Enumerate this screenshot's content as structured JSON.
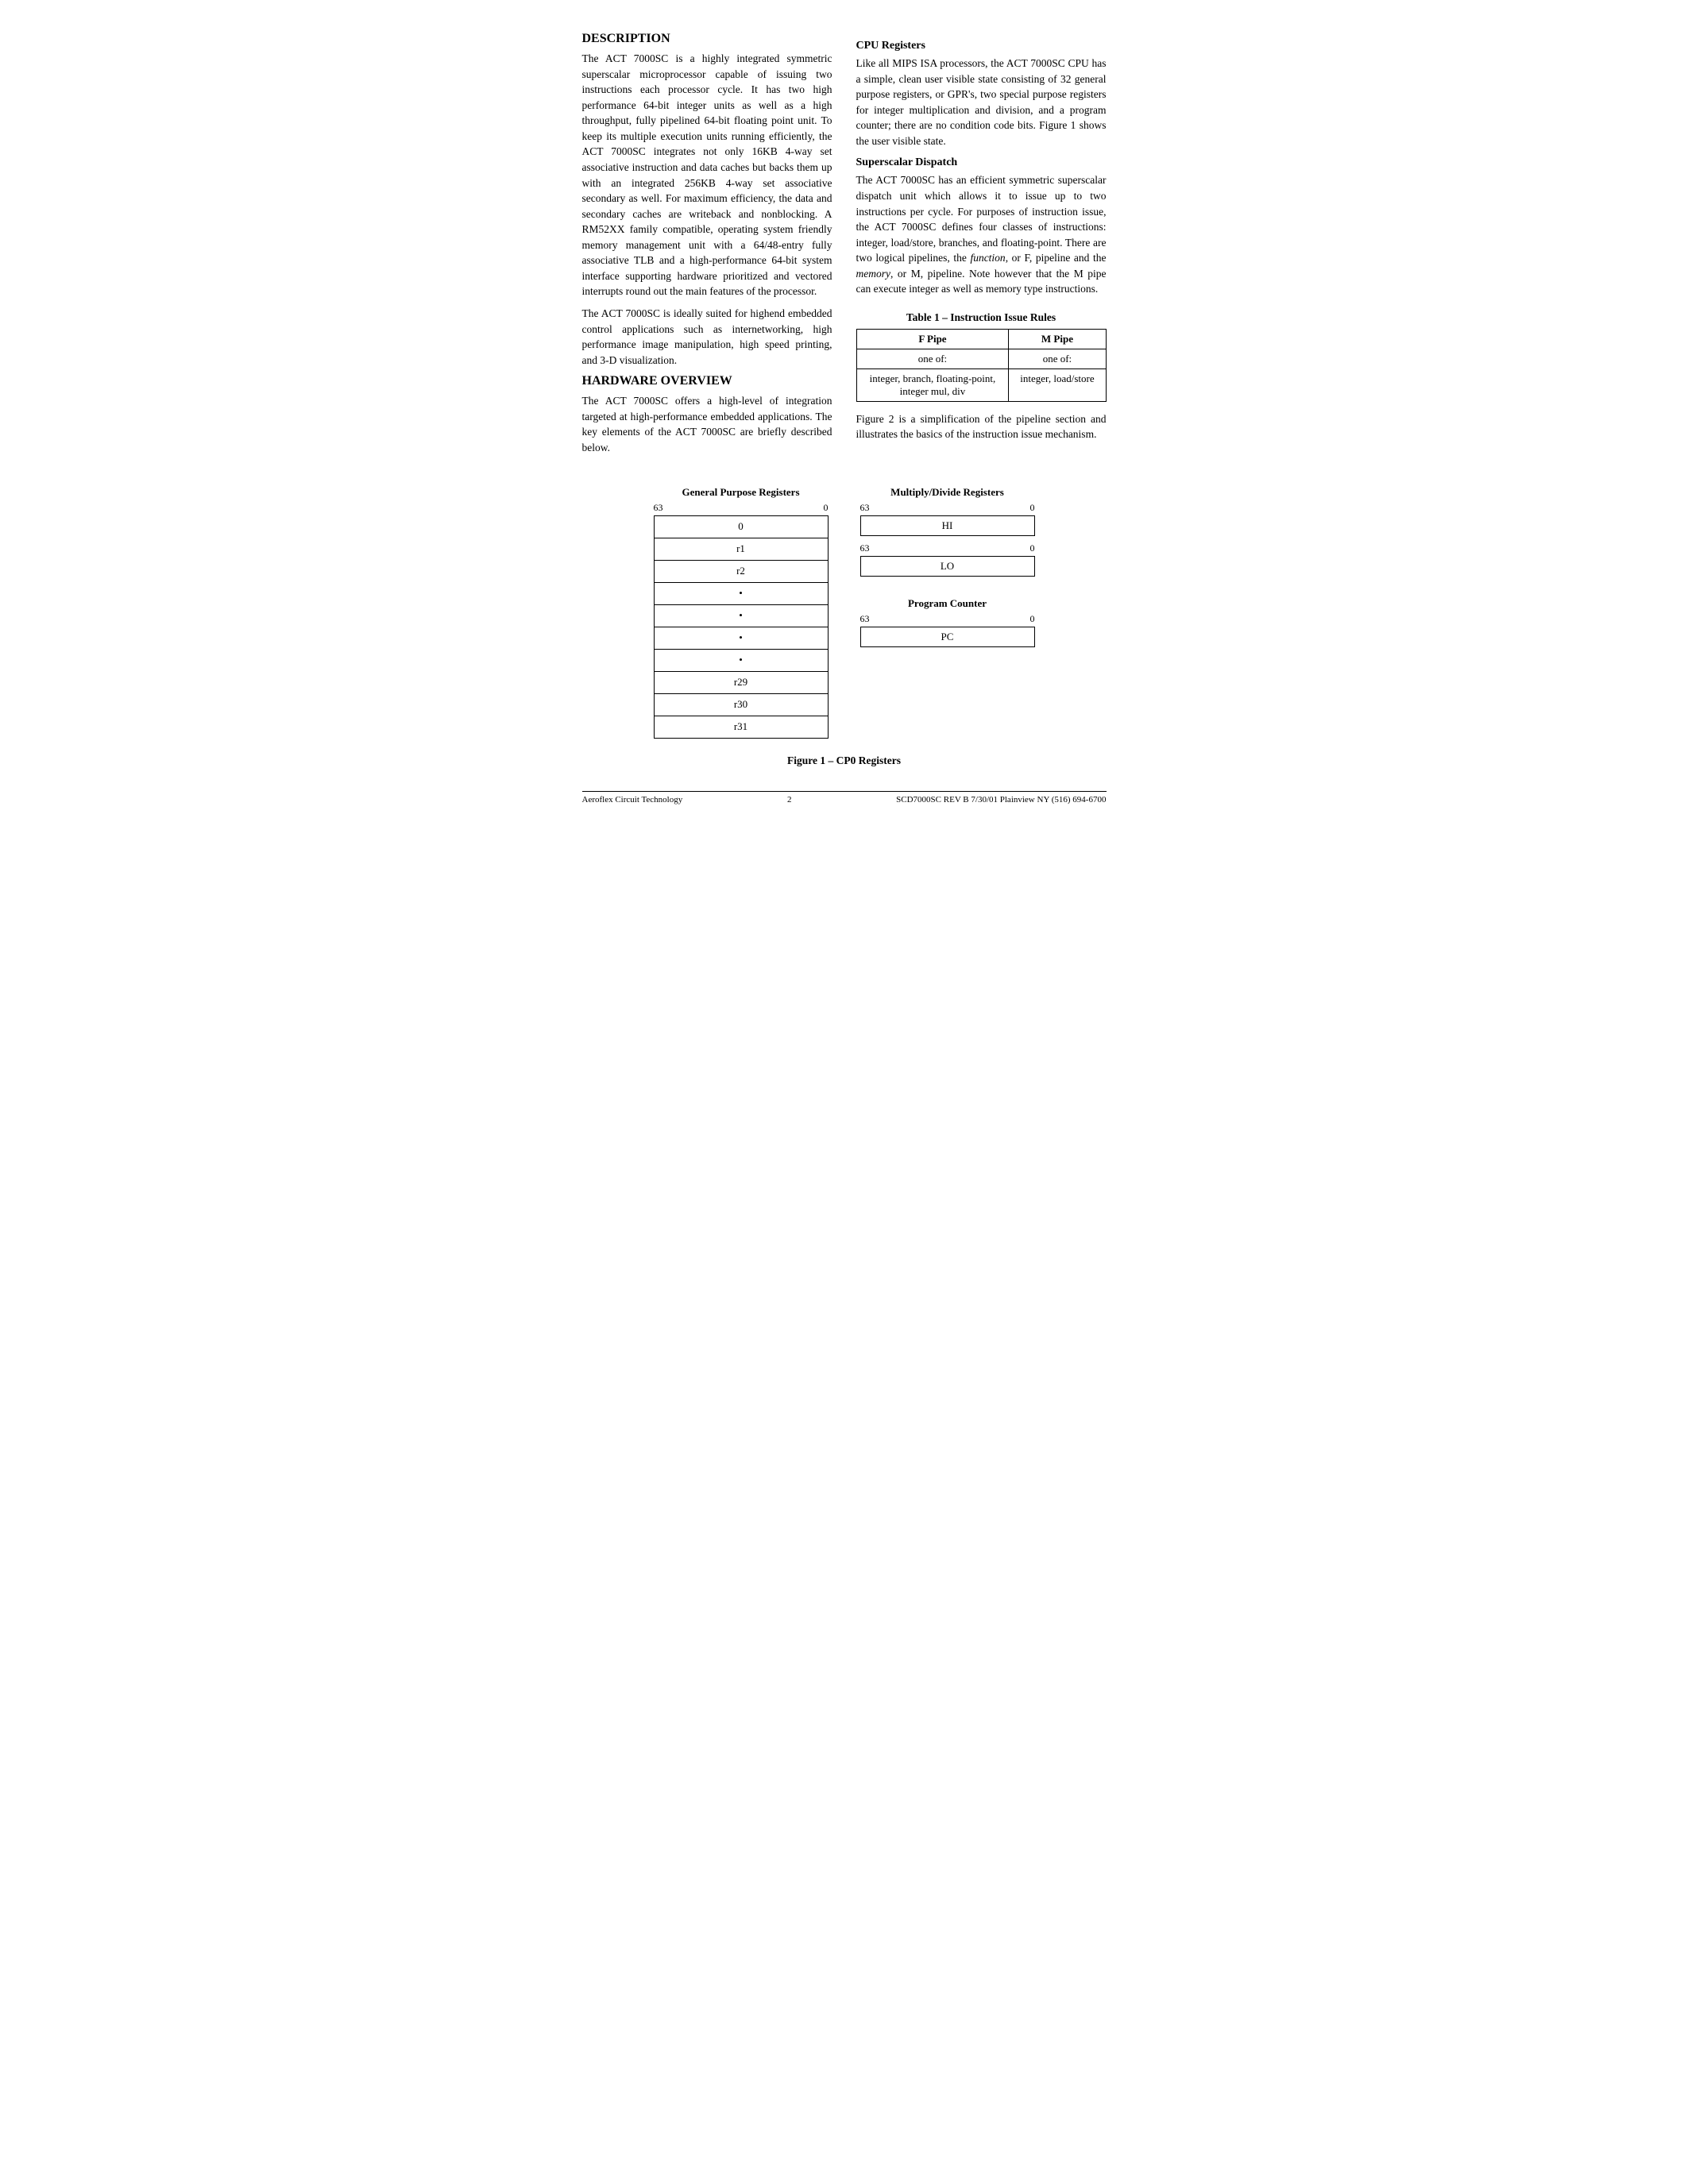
{
  "page": {
    "sections": {
      "description": {
        "title": "DESCRIPTION",
        "paragraphs": [
          "The ACT 7000SC is a highly integrated symmetric superscalar microprocessor capable of issuing two instructions each processor cycle. It has two high performance 64-bit integer units as well as a high throughput, fully pipelined 64-bit floating point unit. To keep its multiple execution units running efficiently, the ACT 7000SC integrates not only 16KB 4-way set associative instruction and data caches but backs them up with an integrated 256KB 4-way set associative secondary as well. For maximum efficiency, the data and secondary caches are writeback and nonblocking. A RM52XX family compatible, operating system friendly memory management unit with a 64/48-entry fully associative TLB and a high-performance 64-bit system interface supporting hardware prioritized and vectored interrupts round out the main features of the processor.",
          "The ACT 7000SC is ideally suited for highend embedded control applications such as internetworking, high performance image manipulation, high speed printing, and 3-D visualization."
        ]
      },
      "hardware_overview": {
        "title": "HARDWARE OVERVIEW",
        "paragraph": "The ACT 7000SC offers a high-level of integration targeted at high-performance embedded applications. The key elements of the ACT 7000SC are briefly described below."
      },
      "cpu_registers": {
        "title": "CPU Registers",
        "paragraph": "Like all MIPS ISA processors, the ACT 7000SC CPU has a simple, clean user visible state consisting of 32 general purpose registers, or GPR's, two special purpose registers for integer multiplication and division, and a program counter; there are no condition code bits. Figure 1 shows the user visible state."
      },
      "superscalar_dispatch": {
        "title": "Superscalar Dispatch",
        "paragraph": "The ACT 7000SC has an efficient symmetric superscalar dispatch unit which allows it to issue up to two instructions per cycle. For purposes of instruction issue, the ACT 7000SC defines four classes of instructions: integer, load/store, branches, and floating-point. There are two logical pipelines, the function, or F, pipeline and the memory, or M, pipeline. Note however that the M pipe can execute integer as well as memory type instructions."
      },
      "table": {
        "title": "Table 1 – Instruction Issue Rules",
        "headers": [
          "F Pipe",
          "M Pipe"
        ],
        "rows": [
          [
            "one of:",
            "one of:"
          ],
          [
            "integer, branch, floating-point,\ninteger mul, div",
            "integer, load/store"
          ]
        ]
      },
      "figure_note": "Figure 2 is a simplification of the pipeline section and illustrates the basics of the instruction issue mechanism."
    },
    "figure": {
      "caption": "Figure 1 – CP0 Registers",
      "gpr": {
        "title": "General Purpose Registers",
        "bit_high": "63",
        "bit_low": "0",
        "rows": [
          "0",
          "r1",
          "r2",
          "•",
          "•",
          "•",
          "•",
          "r29",
          "r30",
          "r31"
        ]
      },
      "multiply_divide": {
        "title": "Multiply/Divide Registers",
        "hi": {
          "bit_high": "63",
          "bit_low": "0",
          "label": "HI"
        },
        "lo": {
          "bit_high": "63",
          "bit_low": "0",
          "label": "LO"
        }
      },
      "program_counter": {
        "title": "Program Counter",
        "bit_high": "63",
        "bit_low": "0",
        "label": "PC"
      }
    },
    "footer": {
      "left": "Aeroflex Circuit Technology",
      "center": "2",
      "right": "SCD7000SC REV B  7/30/01  Plainview NY (516) 694-6700"
    }
  }
}
